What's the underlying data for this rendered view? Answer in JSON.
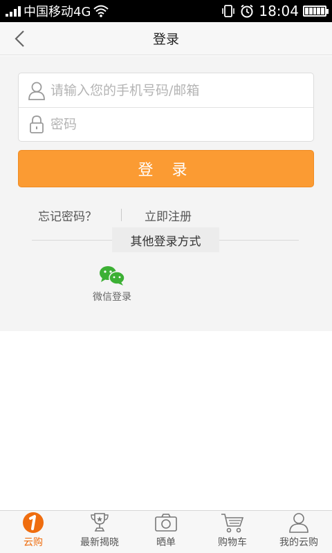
{
  "status_bar": {
    "carrier": "中国移动4G",
    "time": "18:04"
  },
  "header": {
    "title": "登录"
  },
  "form": {
    "account_placeholder": "请输入您的手机号码/邮箱",
    "account_value": "",
    "password_placeholder": "密码",
    "password_value": "",
    "login_label": "登 录"
  },
  "links": {
    "forgot": "忘记密码？",
    "register": "立即注册"
  },
  "other_login": {
    "title": "其他登录方式",
    "wechat_label": "微信登录"
  },
  "bottom_nav": {
    "items": [
      {
        "label": "云购",
        "icon": "yungou-logo-icon",
        "active": true
      },
      {
        "label": "最新揭晓",
        "icon": "trophy-icon",
        "active": false
      },
      {
        "label": "晒单",
        "icon": "camera-icon",
        "active": false
      },
      {
        "label": "购物车",
        "icon": "cart-icon",
        "active": false
      },
      {
        "label": "我的云购",
        "icon": "user-icon",
        "active": false
      }
    ]
  },
  "colors": {
    "accent": "#fb9b33",
    "active_nav": "#ef6d0f",
    "wechat": "#3cb034"
  }
}
